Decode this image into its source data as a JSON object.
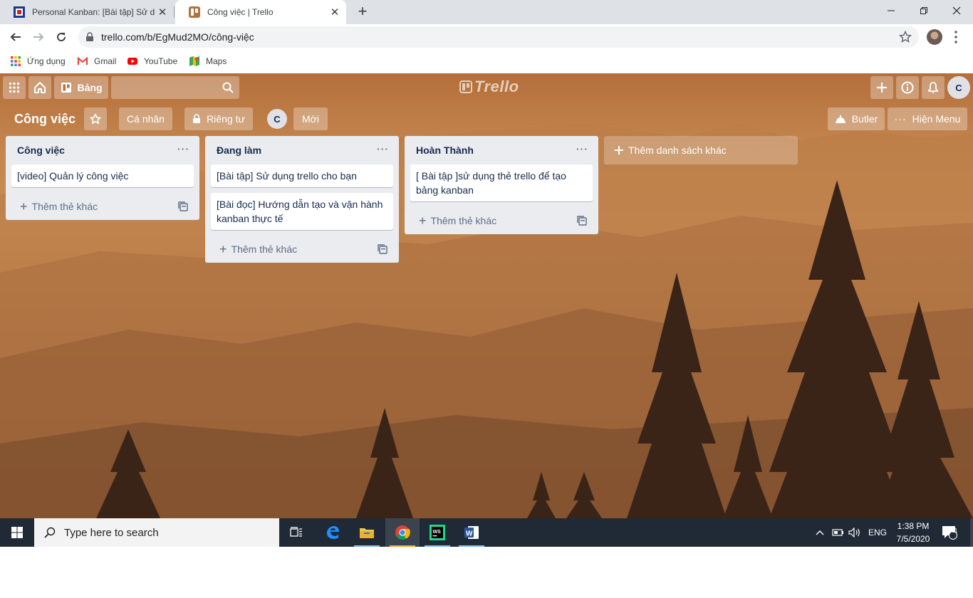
{
  "browser": {
    "tabs": [
      {
        "title": "Personal Kanban: [Bài tập] Sử dụng",
        "active": false
      },
      {
        "title": "Công việc | Trello",
        "active": true
      }
    ],
    "url": "trello.com/b/EgMud2MO/công-việc",
    "bookmarks": [
      {
        "label": "Ứng dụng",
        "icon": "apps-grid-icon"
      },
      {
        "label": "Gmail",
        "icon": "gmail-icon"
      },
      {
        "label": "YouTube",
        "icon": "youtube-icon"
      },
      {
        "label": "Maps",
        "icon": "maps-icon"
      }
    ]
  },
  "trello": {
    "header": {
      "boards_label": "Bảng",
      "logo_text": "Trello",
      "avatar_initial": "C"
    },
    "board": {
      "title": "Công việc",
      "team_label": "Cá nhân",
      "visibility_label": "Riêng tư",
      "member_initial": "C",
      "invite_label": "Mời",
      "butler_label": "Butler",
      "menu_label": "Hiện Menu"
    },
    "lists": [
      {
        "title": "Công việc",
        "cards": [
          "[video] Quản lý công việc"
        ],
        "add_card_label": "Thêm thẻ khác"
      },
      {
        "title": "Đang làm",
        "cards": [
          "[Bài tập] Sử dụng trello cho bạn",
          "[Bài đọc] Hướng dẫn tạo và vận hành kanban thực tế"
        ],
        "add_card_label": "Thêm thẻ khác"
      },
      {
        "title": "Hoàn Thành",
        "cards": [
          "[ Bài tập ]sử dụng thẻ trello để tạo bảng kanban"
        ],
        "add_card_label": "Thêm thẻ khác"
      }
    ],
    "add_list_label": "Thêm danh sách khác"
  },
  "taskbar": {
    "search_placeholder": "Type here to search",
    "language": "ENG",
    "time": "1:38 PM",
    "date": "7/5/2020",
    "notification_count": "11"
  },
  "colors": {
    "list_bg": "#ebecf0",
    "card_text": "#172b4d",
    "taskbar": "#202a36"
  }
}
